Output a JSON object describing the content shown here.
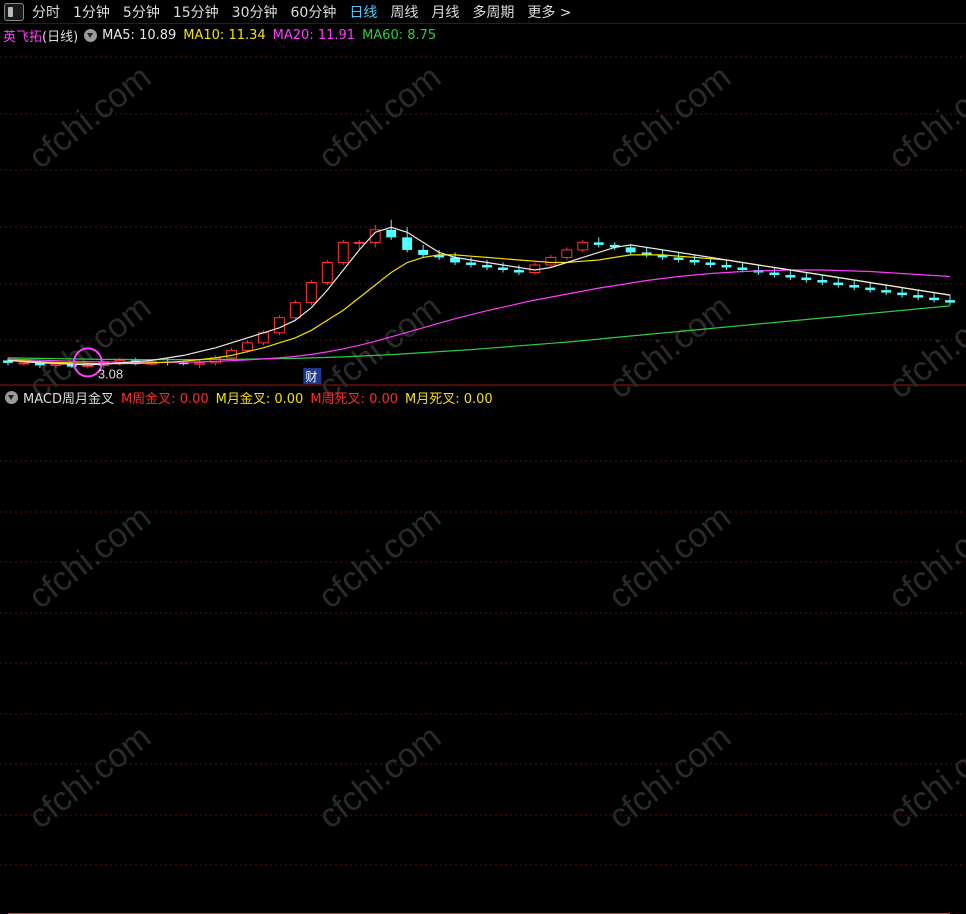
{
  "toolbar": {
    "tabs": [
      {
        "label": "分时"
      },
      {
        "label": "1分钟"
      },
      {
        "label": "5分钟"
      },
      {
        "label": "15分钟"
      },
      {
        "label": "30分钟"
      },
      {
        "label": "60分钟"
      },
      {
        "label": "日线"
      },
      {
        "label": "周线"
      },
      {
        "label": "月线"
      },
      {
        "label": "多周期"
      },
      {
        "label": "更多 >"
      }
    ],
    "active_tab": "日线"
  },
  "main_panel": {
    "stock_name": "英飞拓",
    "period": "(日线)",
    "ma": [
      {
        "label": "MA5: 10.89",
        "color": "#e8e8e8"
      },
      {
        "label": "MA10: 11.34",
        "color": "#f5e000"
      },
      {
        "label": "MA20: 11.91",
        "color": "#ff3cff"
      },
      {
        "label": "MA60: 8.75",
        "color": "#2ecc40"
      }
    ],
    "low_label": "3.08",
    "event_badge": "财"
  },
  "macd_panel": {
    "title": "MACD周月金叉",
    "items": [
      {
        "label": "M周金叉: 0.00",
        "color": "#ff2a2a"
      },
      {
        "label": "M月金叉: 0.00",
        "color": "#f5e000"
      },
      {
        "label": "M周死叉: 0.00",
        "color": "#ff2a2a"
      },
      {
        "label": "M月死叉: 0.00",
        "color": "#f5e000"
      }
    ]
  },
  "watermark": "cfchi.com",
  "chart_data": [
    {
      "type": "candlestick",
      "description": "daily K-line with MA5/MA10/MA20/MA60",
      "ylim": [
        2.5,
        16
      ],
      "colors": {
        "up": "#ff3232",
        "down": "#54ffff",
        "ma5": "#e8e8e8",
        "ma10": "#f5e000",
        "ma20": "#ff3cff",
        "ma60": "#2ecc40"
      },
      "candles": [
        [
          3.4,
          3.5,
          3.2,
          3.3
        ],
        [
          3.3,
          3.4,
          3.2,
          3.3
        ],
        [
          3.3,
          3.4,
          3.1,
          3.2
        ],
        [
          3.2,
          3.3,
          3.1,
          3.25
        ],
        [
          3.25,
          3.3,
          3.1,
          3.15
        ],
        [
          3.15,
          3.3,
          3.08,
          3.2
        ],
        [
          3.2,
          3.4,
          3.1,
          3.3
        ],
        [
          3.3,
          3.5,
          3.2,
          3.4
        ],
        [
          3.4,
          3.5,
          3.2,
          3.25
        ],
        [
          3.25,
          3.4,
          3.2,
          3.35
        ],
        [
          3.35,
          3.5,
          3.2,
          3.3
        ],
        [
          3.3,
          3.4,
          3.2,
          3.25
        ],
        [
          3.25,
          3.4,
          3.1,
          3.3
        ],
        [
          3.3,
          3.6,
          3.2,
          3.5
        ],
        [
          3.5,
          3.9,
          3.4,
          3.8
        ],
        [
          3.8,
          4.2,
          3.7,
          4.1
        ],
        [
          4.1,
          4.6,
          4.0,
          4.5
        ],
        [
          4.5,
          5.2,
          4.4,
          5.1
        ],
        [
          5.1,
          5.8,
          5.0,
          5.7
        ],
        [
          5.7,
          6.6,
          5.6,
          6.5
        ],
        [
          6.5,
          7.4,
          6.4,
          7.3
        ],
        [
          7.3,
          8.2,
          7.2,
          8.1
        ],
        [
          8.1,
          8.2,
          7.8,
          8.1
        ],
        [
          8.1,
          8.8,
          7.9,
          8.6
        ],
        [
          8.6,
          9.0,
          8.2,
          8.3
        ],
        [
          8.3,
          8.7,
          7.7,
          7.8
        ],
        [
          7.8,
          8.0,
          7.5,
          7.6
        ],
        [
          7.6,
          7.8,
          7.4,
          7.5
        ],
        [
          7.5,
          7.7,
          7.2,
          7.3
        ],
        [
          7.3,
          7.5,
          7.1,
          7.2
        ],
        [
          7.2,
          7.4,
          7.0,
          7.1
        ],
        [
          7.1,
          7.3,
          6.9,
          7.0
        ],
        [
          7.0,
          7.2,
          6.8,
          6.9
        ],
        [
          6.9,
          7.3,
          6.8,
          7.2
        ],
        [
          7.2,
          7.6,
          7.1,
          7.5
        ],
        [
          7.5,
          7.9,
          7.4,
          7.8
        ],
        [
          7.8,
          8.2,
          7.7,
          8.1
        ],
        [
          8.1,
          8.3,
          7.9,
          8.0
        ],
        [
          8.0,
          8.1,
          7.8,
          7.9
        ],
        [
          7.9,
          8.0,
          7.6,
          7.7
        ],
        [
          7.7,
          7.9,
          7.5,
          7.6
        ],
        [
          7.6,
          7.8,
          7.4,
          7.5
        ],
        [
          7.5,
          7.7,
          7.3,
          7.4
        ],
        [
          7.4,
          7.6,
          7.2,
          7.3
        ],
        [
          7.3,
          7.5,
          7.1,
          7.2
        ],
        [
          7.2,
          7.4,
          7.0,
          7.1
        ],
        [
          7.1,
          7.3,
          6.9,
          7.0
        ],
        [
          7.0,
          7.2,
          6.8,
          6.9
        ],
        [
          6.9,
          7.1,
          6.7,
          6.8
        ],
        [
          6.8,
          7.0,
          6.6,
          6.7
        ],
        [
          6.7,
          6.9,
          6.5,
          6.6
        ],
        [
          6.6,
          6.8,
          6.4,
          6.5
        ],
        [
          6.5,
          6.7,
          6.3,
          6.4
        ],
        [
          6.4,
          6.6,
          6.2,
          6.3
        ],
        [
          6.3,
          6.5,
          6.1,
          6.2
        ],
        [
          6.2,
          6.4,
          6.0,
          6.1
        ],
        [
          6.1,
          6.3,
          5.9,
          6.0
        ],
        [
          6.0,
          6.2,
          5.8,
          5.9
        ],
        [
          5.9,
          6.1,
          5.7,
          5.8
        ],
        [
          5.8,
          6.0,
          5.6,
          5.7
        ]
      ],
      "ma5": [
        3.4,
        3.35,
        3.3,
        3.28,
        3.25,
        3.22,
        3.25,
        3.3,
        3.35,
        3.4,
        3.5,
        3.6,
        3.75,
        3.9,
        4.1,
        4.3,
        4.5,
        4.7,
        5.0,
        5.5,
        6.2,
        7.0,
        7.8,
        8.5,
        8.7,
        8.5,
        8.1,
        7.7,
        7.5,
        7.4,
        7.3,
        7.2,
        7.1,
        7.0,
        7.1,
        7.3,
        7.5,
        7.7,
        7.9,
        8.0,
        7.9,
        7.8,
        7.7,
        7.6,
        7.5,
        7.4,
        7.3,
        7.2,
        7.1,
        7.0,
        6.9,
        6.8,
        6.7,
        6.6,
        6.5,
        6.4,
        6.3,
        6.2,
        6.1,
        6.0
      ],
      "ma10": [
        3.4,
        3.38,
        3.35,
        3.32,
        3.3,
        3.28,
        3.27,
        3.27,
        3.28,
        3.3,
        3.33,
        3.37,
        3.43,
        3.5,
        3.6,
        3.75,
        3.9,
        4.1,
        4.3,
        4.6,
        5.0,
        5.4,
        5.9,
        6.4,
        6.9,
        7.3,
        7.5,
        7.6,
        7.6,
        7.55,
        7.5,
        7.45,
        7.4,
        7.35,
        7.3,
        7.3,
        7.35,
        7.4,
        7.5,
        7.6,
        7.6,
        7.6,
        7.55,
        7.5,
        7.45,
        7.4,
        7.3,
        7.2,
        7.1,
        7.0,
        6.9,
        6.8,
        6.7,
        6.6,
        6.5,
        6.4,
        6.3,
        6.2,
        6.1,
        6.0
      ],
      "ma20": [
        3.45,
        3.43,
        3.41,
        3.39,
        3.37,
        3.35,
        3.34,
        3.33,
        3.32,
        3.32,
        3.32,
        3.33,
        3.34,
        3.36,
        3.39,
        3.42,
        3.46,
        3.5,
        3.56,
        3.64,
        3.74,
        3.86,
        4.0,
        4.16,
        4.34,
        4.52,
        4.7,
        4.88,
        5.06,
        5.22,
        5.38,
        5.52,
        5.66,
        5.8,
        5.92,
        6.04,
        6.16,
        6.28,
        6.38,
        6.48,
        6.58,
        6.66,
        6.74,
        6.8,
        6.86,
        6.9,
        6.94,
        6.96,
        6.98,
        7.0,
        7.0,
        7.0,
        6.98,
        6.96,
        6.94,
        6.9,
        6.86,
        6.82,
        6.78,
        6.74
      ],
      "ma60": [
        3.5,
        3.49,
        3.48,
        3.47,
        3.46,
        3.45,
        3.44,
        3.44,
        3.43,
        3.43,
        3.43,
        3.43,
        3.43,
        3.44,
        3.44,
        3.45,
        3.46,
        3.47,
        3.48,
        3.5,
        3.52,
        3.54,
        3.57,
        3.6,
        3.63,
        3.67,
        3.71,
        3.75,
        3.79,
        3.83,
        3.88,
        3.93,
        3.98,
        4.03,
        4.08,
        4.13,
        4.19,
        4.25,
        4.31,
        4.37,
        4.43,
        4.49,
        4.55,
        4.61,
        4.67,
        4.73,
        4.79,
        4.85,
        4.91,
        4.97,
        5.03,
        5.09,
        5.15,
        5.21,
        5.27,
        5.33,
        5.39,
        5.45,
        5.51,
        5.57
      ]
    },
    {
      "type": "line",
      "description": "MACD周月金叉 indicator",
      "ylim": [
        0,
        1
      ],
      "series": [
        {
          "name": "M周金叉",
          "color": "#ff2a2a",
          "values": [
            0,
            0,
            0,
            0,
            0,
            0,
            0,
            0,
            0,
            0,
            0,
            0,
            0,
            0,
            0,
            0,
            0,
            0,
            0,
            0,
            0,
            0,
            0,
            0,
            0,
            0,
            0,
            0,
            0,
            0,
            0,
            0,
            0,
            0,
            0,
            0,
            0,
            0,
            0,
            0,
            0,
            0,
            0,
            0,
            0,
            0,
            0,
            0,
            0,
            0,
            0,
            0,
            0,
            0,
            0,
            0,
            0,
            0,
            0,
            0
          ]
        }
      ]
    }
  ]
}
